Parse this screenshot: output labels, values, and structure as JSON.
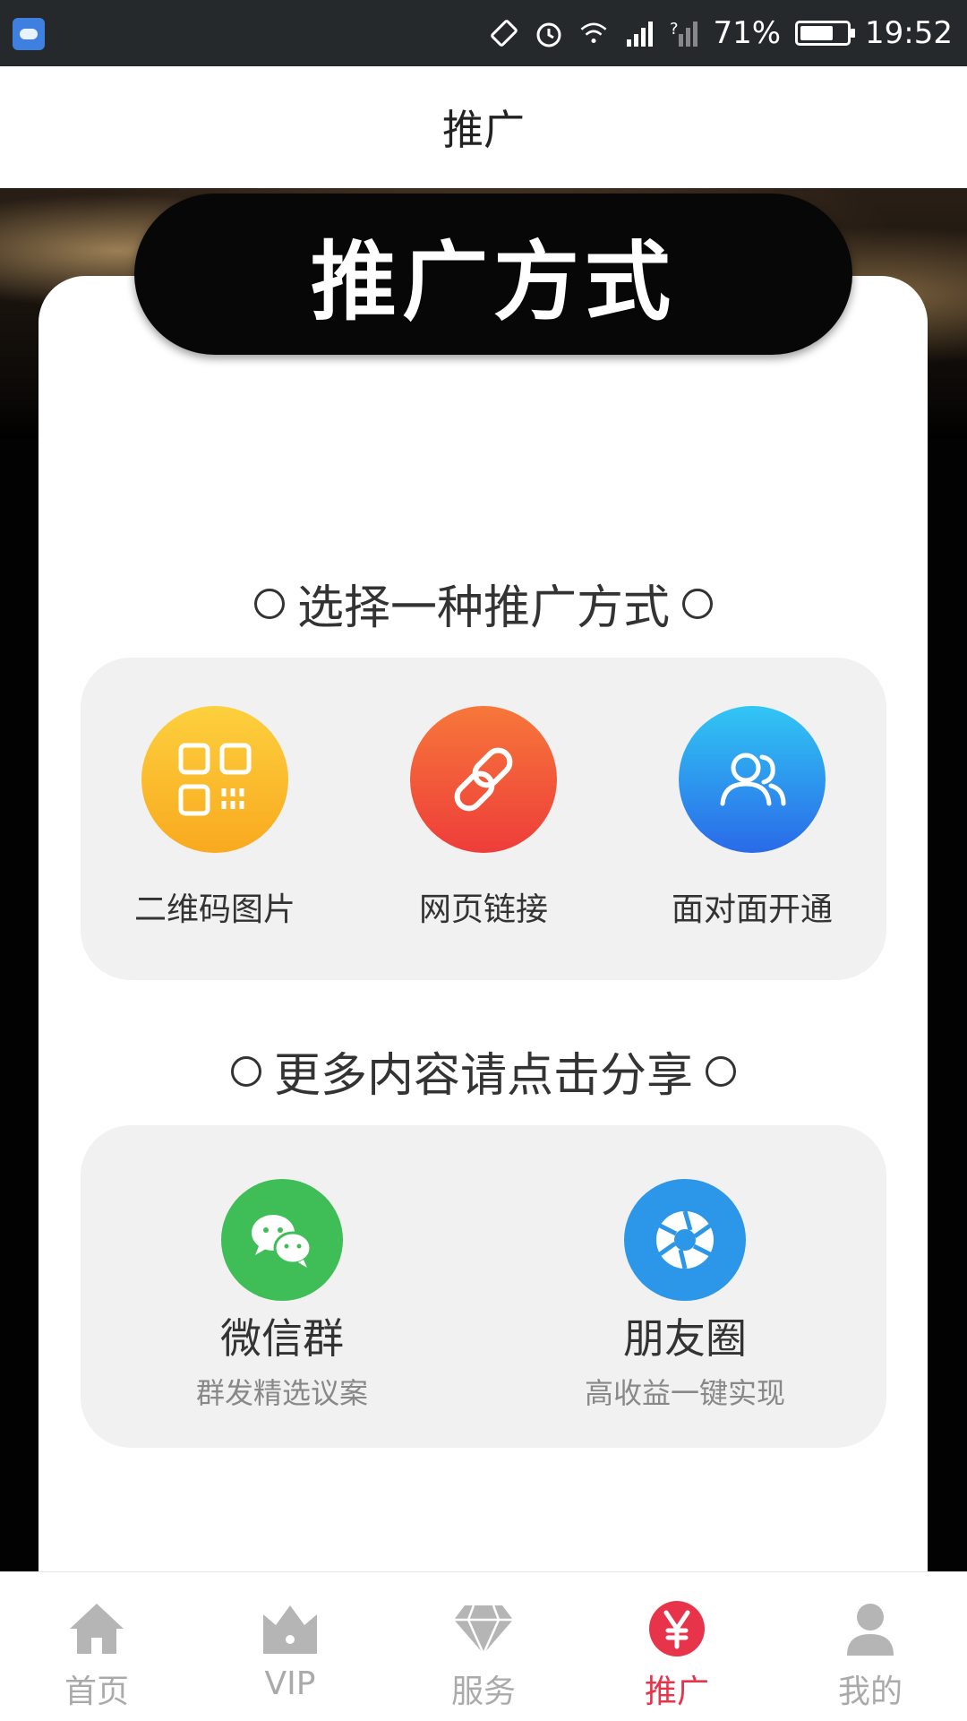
{
  "status_bar": {
    "battery": "71%",
    "battery_level": 0.71,
    "time": "19:52",
    "icons": [
      "weather-app-icon",
      "rotate-icon",
      "alarm-icon",
      "wifi-icon",
      "signal-icon",
      "no-signal-icon",
      "battery-icon"
    ]
  },
  "header": {
    "title": "推广"
  },
  "banner": {
    "title": "推广方式"
  },
  "section1": {
    "title": "选择一种推广方式",
    "options": [
      {
        "label": "二维码图片",
        "icon": "qrcode-icon",
        "color": "#fbb52c"
      },
      {
        "label": "网页链接",
        "icon": "link-icon",
        "color": "#f2503a"
      },
      {
        "label": "面对面开通",
        "icon": "users-icon",
        "color": "#2f8df0"
      }
    ]
  },
  "section2": {
    "title": "更多内容请点击分享",
    "shares": [
      {
        "name": "微信群",
        "sub": "群发精选议案",
        "icon": "wechat-icon",
        "color": "#3fbe57"
      },
      {
        "name": "朋友圈",
        "sub": "高收益一键实现",
        "icon": "moments-icon",
        "color": "#2c97e8"
      }
    ]
  },
  "bottom_nav": {
    "items": [
      {
        "label": "首页",
        "icon": "home-icon"
      },
      {
        "label": "VIP",
        "icon": "crown-icon"
      },
      {
        "label": "服务",
        "icon": "diamond-icon"
      },
      {
        "label": "推广",
        "icon": "yen-icon"
      },
      {
        "label": "我的",
        "icon": "user-icon"
      }
    ],
    "active_index": 3,
    "active_color": "#e8344a",
    "inactive_color": "#aaaaaa"
  }
}
